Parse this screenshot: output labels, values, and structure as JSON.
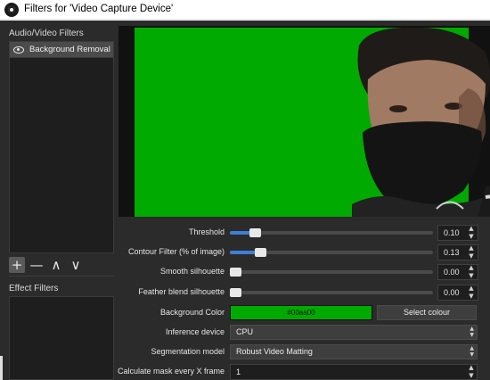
{
  "window": {
    "title": "Filters for 'Video Capture Device'",
    "icon": "obs-logo-icon"
  },
  "left_panel": {
    "av_filters_label": "Audio/Video Filters",
    "av_filters": [
      {
        "label": "Background Removal",
        "icon": "eye-icon"
      }
    ],
    "toolbar": {
      "add": "+",
      "remove": "—",
      "up": "∧",
      "down": "∨"
    },
    "effect_filters_label": "Effect Filters"
  },
  "preview": {
    "chroma_color": "#00aa00"
  },
  "properties": {
    "threshold": {
      "label": "Threshold",
      "value": "0.10",
      "level": 0.1
    },
    "contour_filter": {
      "label": "Contour Filter (% of image)",
      "value": "0.13",
      "level": 0.13
    },
    "smooth_silhouette": {
      "label": "Smooth silhouette",
      "value": "0.00",
      "level": 0.0
    },
    "feather_blend": {
      "label": "Feather blend silhouette",
      "value": "0.00",
      "level": 0.0
    },
    "background_color": {
      "label": "Background Color",
      "value": "#00aa00",
      "button": "Select colour"
    },
    "inference_device": {
      "label": "Inference device",
      "value": "CPU"
    },
    "segmentation_model": {
      "label": "Segmentation model",
      "value": "Robust Video Matting"
    },
    "calculate_mask": {
      "label": "Calculate mask every X frame",
      "value": "1"
    }
  },
  "colors": {
    "accent": "#3b7fd6",
    "panel": "#2b2b2b",
    "field": "#1e1e1e"
  }
}
